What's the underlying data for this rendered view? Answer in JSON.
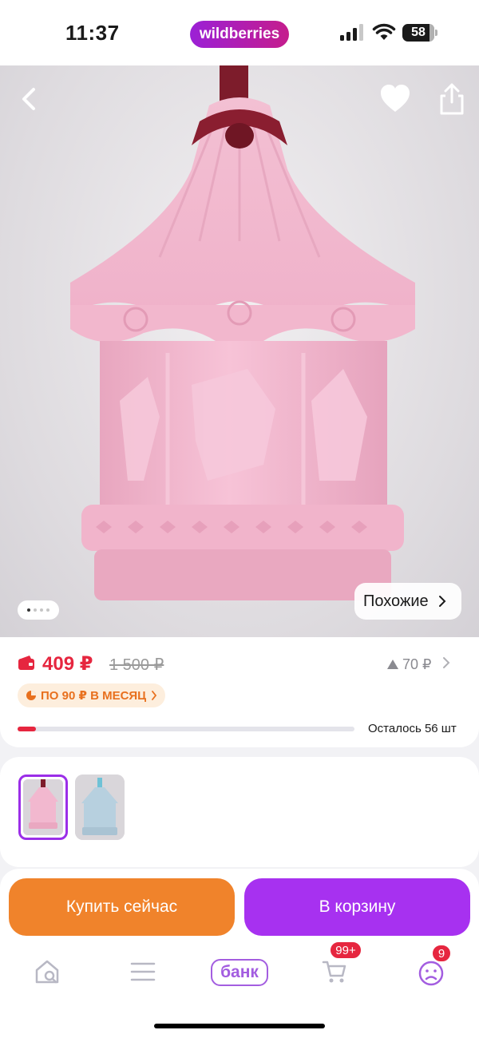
{
  "status_bar": {
    "time": "11:37",
    "brand": "wildberries",
    "battery": "58",
    "icons": [
      "signal-icon",
      "wifi-icon",
      "battery-icon"
    ]
  },
  "hero": {
    "icons": [
      "back-arrow-icon",
      "heart-icon",
      "share-icon"
    ],
    "similar_label": "Похожие",
    "photo_count": 4,
    "active_photo": 1
  },
  "price": {
    "current": "409 ₽",
    "old": "1 500 ₽",
    "bonus": "70 ₽",
    "installment": "ПО 90 ₽ В МЕСЯЦ",
    "stock_label": "Осталось 56 шт",
    "stock_fraction": 0.055,
    "accent_color": "#e6263f"
  },
  "variants": [
    {
      "name": "pink",
      "selected": true,
      "color": "#f2b8cf"
    },
    {
      "name": "blue",
      "selected": false,
      "color": "#b7d0df"
    }
  ],
  "actions": {
    "buy_now": "Купить сейчас",
    "add_to_cart": "В корзину",
    "buy_color": "#f0832b",
    "cart_color": "#a731f0"
  },
  "tabbar": {
    "bank_label": "банк",
    "cart_badge": "99+",
    "profile_badge": "9",
    "icons": [
      "home-search-icon",
      "catalog-icon",
      "bank-icon",
      "cart-icon",
      "profile-icon"
    ]
  }
}
